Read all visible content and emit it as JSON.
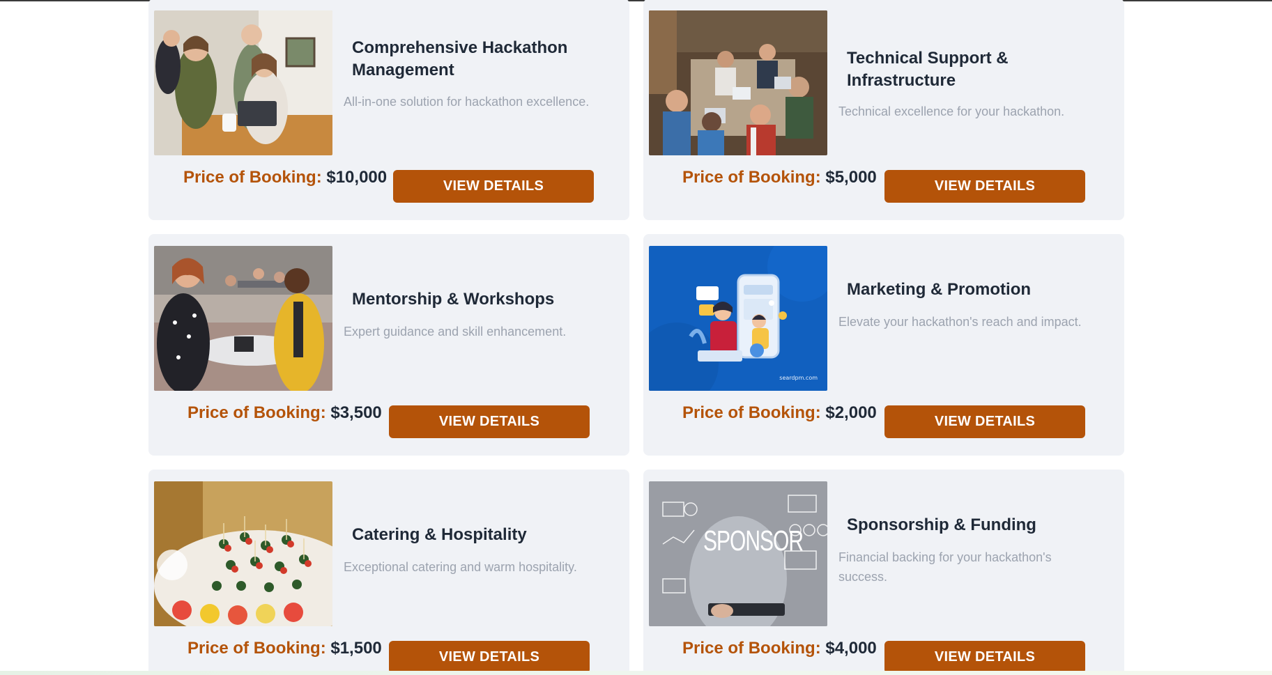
{
  "services": [
    {
      "title": "Comprehensive Hackathon Management",
      "description": "All-in-one solution for hackathon excellence.",
      "price_label": "Price of Booking:",
      "price": "$10,000",
      "button": "VIEW DETAILS",
      "image": "team-laptop-photo"
    },
    {
      "title": "Technical Support & Infrastructure",
      "description": "Technical excellence for your hackathon.",
      "price_label": "Price of Booking:",
      "price": "$5,000",
      "button": "VIEW DETAILS",
      "image": "hackathon-room-photo"
    },
    {
      "title": "Mentorship & Workshops",
      "description": "Expert guidance and skill enhancement.",
      "price_label": "Price of Booking:",
      "price": "$3,500",
      "button": "VIEW DETAILS",
      "image": "mentorship-photo"
    },
    {
      "title": "Marketing & Promotion",
      "description": "Elevate your hackathon's reach and impact.",
      "price_label": "Price of Booking:",
      "price": "$2,000",
      "button": "VIEW DETAILS",
      "image": "marketing-illustration",
      "image_caption": "seardpm.com"
    },
    {
      "title": "Catering & Hospitality",
      "description": "Exceptional catering and warm hospitality.",
      "price_label": "Price of Booking:",
      "price": "$1,500",
      "button": "VIEW DETAILS",
      "image": "catering-photo"
    },
    {
      "title": "Sponsorship & Funding",
      "description": "Financial backing for your hackathon's success.",
      "price_label": "Price of Booking:",
      "price": "$4,000",
      "button": "VIEW DETAILS",
      "image": "sponsorship-photo",
      "image_caption": "SPONSOR"
    }
  ],
  "colors": {
    "accent": "#b45309",
    "card_bg": "#f0f2f6",
    "title": "#1f2937",
    "description": "#9ca3af"
  }
}
